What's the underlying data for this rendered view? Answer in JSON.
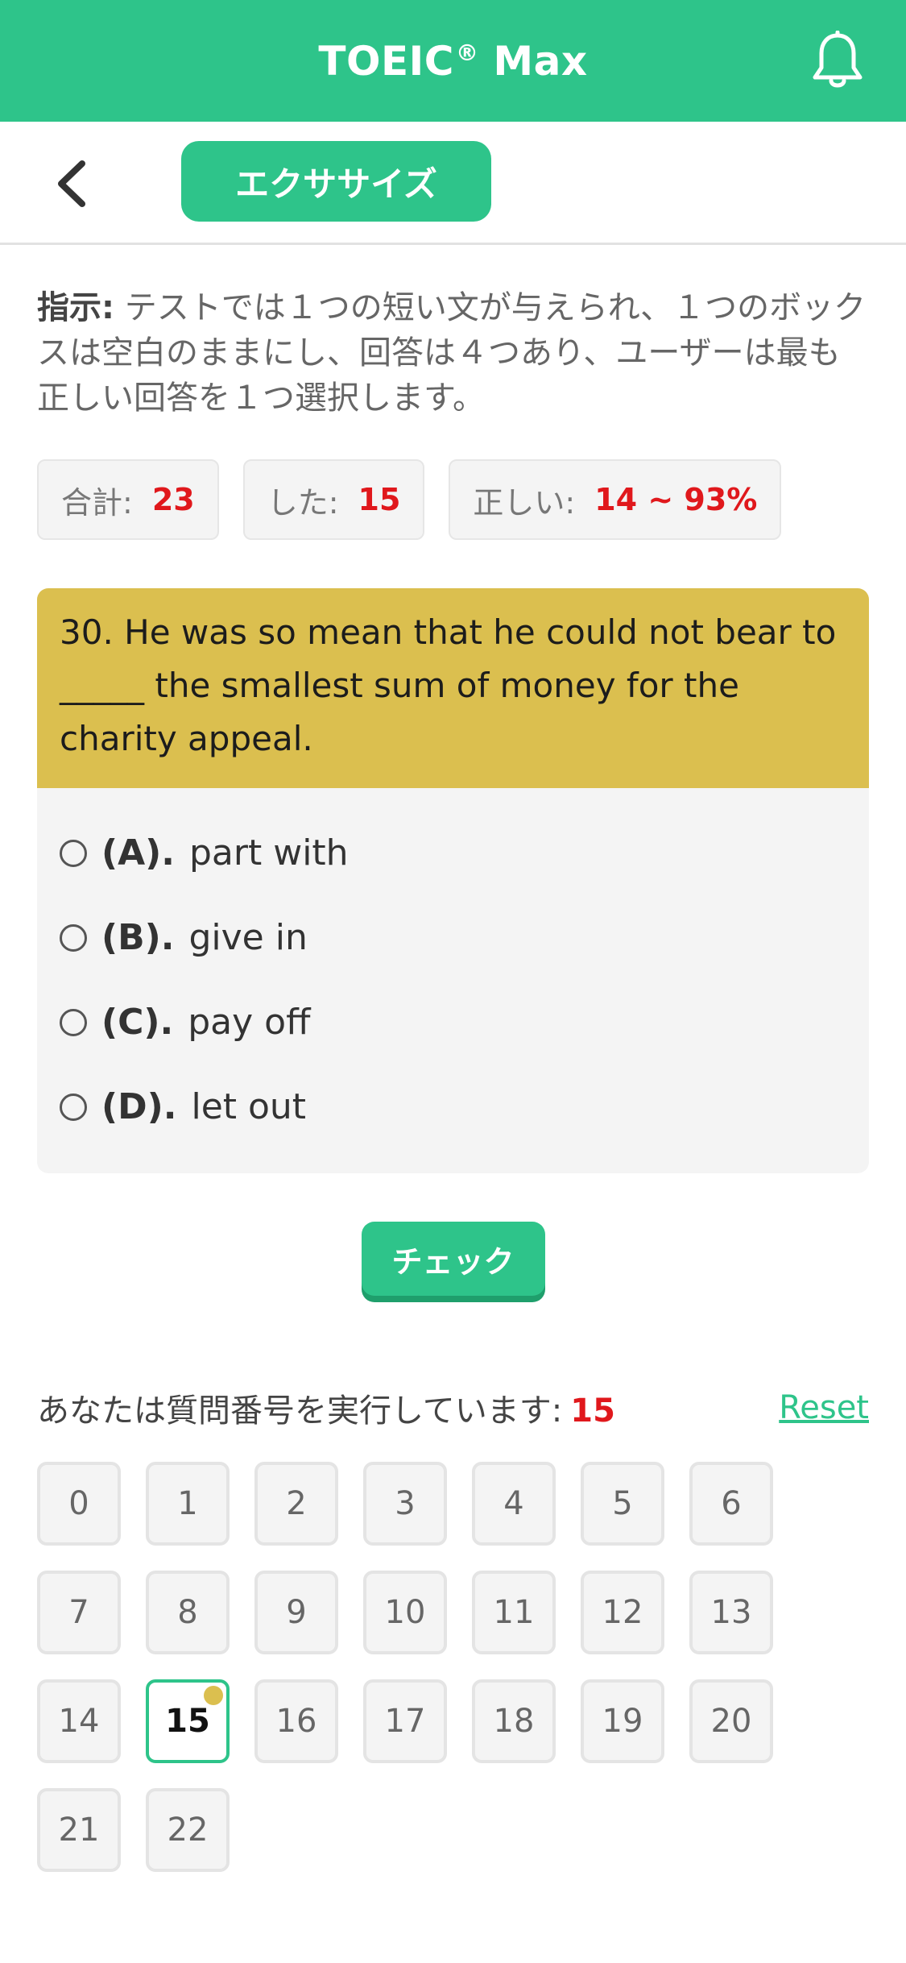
{
  "header": {
    "title": "TOEIC",
    "reg": "®",
    "title_suffix": "Max"
  },
  "subnav": {
    "exercise_label": "エクササイズ"
  },
  "instructions": {
    "label": "指示:",
    "text": " テストでは１つの短い文が与えられ、１つのボックスは空白のままにし、回答は４つあり、ユーザーは最も正しい回答を１つ選択します。"
  },
  "stats": {
    "total_label": "合計:",
    "total_value": "23",
    "done_label": "した:",
    "done_value": "15",
    "correct_label": "正しい:",
    "correct_value": "14 ~ 93%"
  },
  "question": {
    "text": "30. He was so mean that he could not bear to _____ the smallest sum of money for the charity appeal.",
    "options": [
      {
        "letter": "(A).",
        "text": "part with"
      },
      {
        "letter": "(B).",
        "text": "give in"
      },
      {
        "letter": "(C).",
        "text": "pay off"
      },
      {
        "letter": "(D).",
        "text": "let out"
      }
    ]
  },
  "check_label": "チェック",
  "progress": {
    "label": "あなたは質問番号を実行しています:",
    "current": "15",
    "reset_label": "Reset"
  },
  "numbers": [
    "0",
    "1",
    "2",
    "3",
    "4",
    "5",
    "6",
    "7",
    "8",
    "9",
    "10",
    "11",
    "12",
    "13",
    "14",
    "15",
    "16",
    "17",
    "18",
    "19",
    "20",
    "21",
    "22"
  ],
  "active_number": "15",
  "colors": {
    "brand": "#2ec48a",
    "question_bg": "#dbbf4f",
    "accent_red": "#e0181c"
  }
}
